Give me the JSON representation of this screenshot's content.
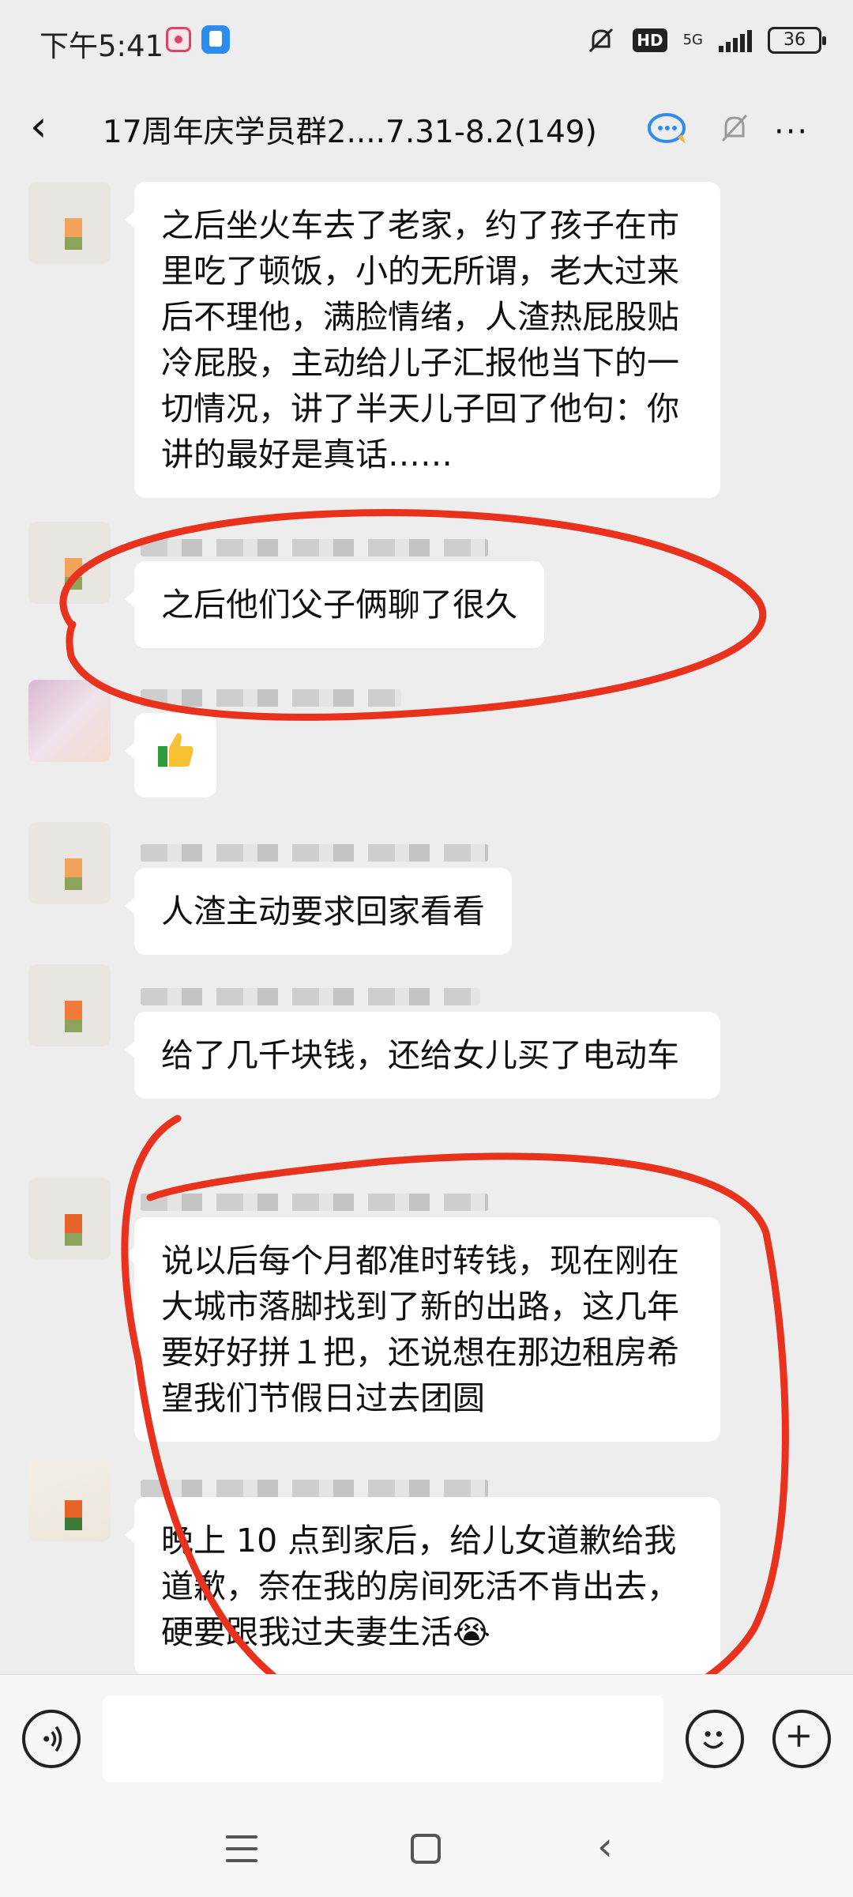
{
  "status_bar": {
    "time": "下午5:41",
    "hd": "HD",
    "network": "5G",
    "battery": "36"
  },
  "header": {
    "back_icon": "chevron-left-icon",
    "title": "17周年庆学员群2....7.31-8.2(149)"
  },
  "messages": [
    {
      "text": "之后坐火车去了老家，约了孩子在市里吃了顿饭，小的无所谓，老大过来后不理他，满脸情绪，人渣热屁股贴冷屁股，主动给儿子汇报他当下的一切情况，讲了半天儿子回了他句：你讲的最好是真话……"
    },
    {
      "text": "之后他们父子俩聊了很久"
    },
    {
      "text": "",
      "emoji": "thumbs-up-icon"
    },
    {
      "text": "人渣主动要求回家看看"
    },
    {
      "text": "给了几千块钱，还给女儿买了电动车"
    },
    {
      "text": "说以后每个月都准时转钱，现在刚在大城市落脚找到了新的出路，这几年要好好拼１把，还说想在那边租房希望我们节假日过去团圆"
    },
    {
      "text": "晚上 10 点到家后，给儿女道歉给我道歉，奈在我的房间死活不肯出去，硬要跟我过夫妻生活😭"
    }
  ],
  "colors": {
    "background": "#ededed",
    "bubble": "#ffffff",
    "annotation": "#e8321e"
  }
}
